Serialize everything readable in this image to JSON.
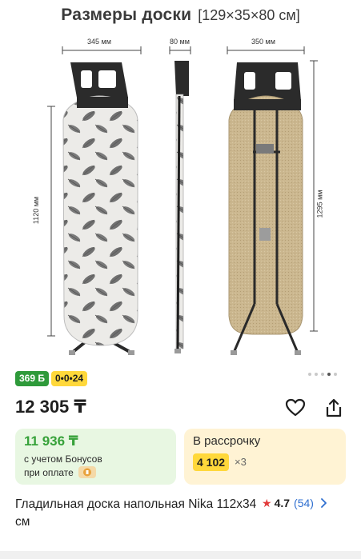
{
  "product_image": {
    "title": "Размеры доски",
    "title_dims": "[129×35×80 см]",
    "dim_width_front": "345 мм",
    "dim_thickness": "80 мм",
    "dim_width_back": "350 мм",
    "dim_length": "1120 мм",
    "dim_height": "1295 мм",
    "colors": {
      "frame": "#2a2a2a",
      "cover_bg": "#ecebe8",
      "feather": "#6a6a6a",
      "back_board": "#c9b58e"
    }
  },
  "badges": {
    "points": "369 Б",
    "installment": "0•0•24"
  },
  "carousel": {
    "total": 5,
    "active_index": 4
  },
  "price": "12 305 ₸",
  "actions": {
    "favorite_icon": "heart-icon",
    "share_icon": "share-icon"
  },
  "bonus_offer": {
    "price": "11 936 ₸",
    "note_line1": "с учетом Бонусов",
    "note_line2": "при оплате"
  },
  "installment_offer": {
    "label": "В рассрочку",
    "amount": "4 102",
    "times": "×3"
  },
  "product": {
    "title": "Гладильная доска напольная Nika 112x34 см",
    "rating": "4.7",
    "reviews": "(54)"
  }
}
